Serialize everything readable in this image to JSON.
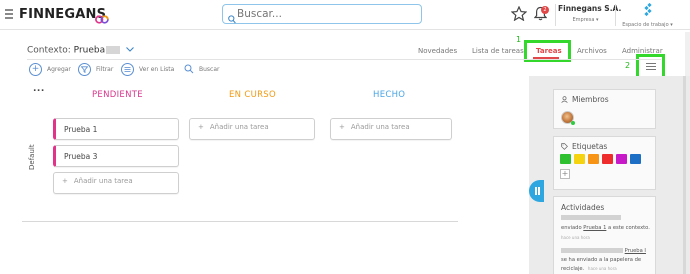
{
  "header": {
    "brand": "FINNEGANS",
    "search_placeholder": "Buscar...",
    "notification_count": "2",
    "company_name": "Finnegans S.A.",
    "company_label": "Empresa",
    "workspace_label": "Espacio de trabajo"
  },
  "context": {
    "label": "Contexto:",
    "value": "Prueba"
  },
  "tabs": [
    {
      "label": "Novedades"
    },
    {
      "label": "Lista de tareas"
    },
    {
      "label": "Tareas"
    },
    {
      "label": "Archivos"
    },
    {
      "label": "Administrar"
    }
  ],
  "active_tab": "Tareas",
  "annotations": {
    "one": "1",
    "two": "2"
  },
  "toolbar": {
    "add": "Agregar",
    "filter": "Filtrar",
    "list_view": "Ver en Lista",
    "search": "Buscar"
  },
  "board": {
    "more": "...",
    "swimlane": "Default",
    "columns": [
      {
        "title": "PENDIENTE",
        "color": "#d6378b"
      },
      {
        "title": "EN CURSO",
        "color": "#f29a12"
      },
      {
        "title": "HECHO",
        "color": "#4aa5e6"
      }
    ],
    "tasks": [
      {
        "title": "Prueba 1"
      },
      {
        "title": "Prueba 3"
      }
    ],
    "add_task": "Añadir una tarea"
  },
  "sidebar": {
    "members_title": "Miembros",
    "tags_title": "Etiquetas",
    "tag_colors": [
      "#2ec02e",
      "#f5d40f",
      "#f79415",
      "#ef2c2c",
      "#c719c7",
      "#1d6fc6"
    ],
    "activities_title": "Actividades",
    "activity1": {
      "prefix": "enviado",
      "link": "Prueba 1",
      "suffix": "a este contexto.",
      "time": "hace una hora"
    },
    "activity2": {
      "link": "Prueba I",
      "line2": "se ha enviado a la papelera de",
      "line3": "reciclaje.",
      "time": "hace una hora"
    }
  }
}
